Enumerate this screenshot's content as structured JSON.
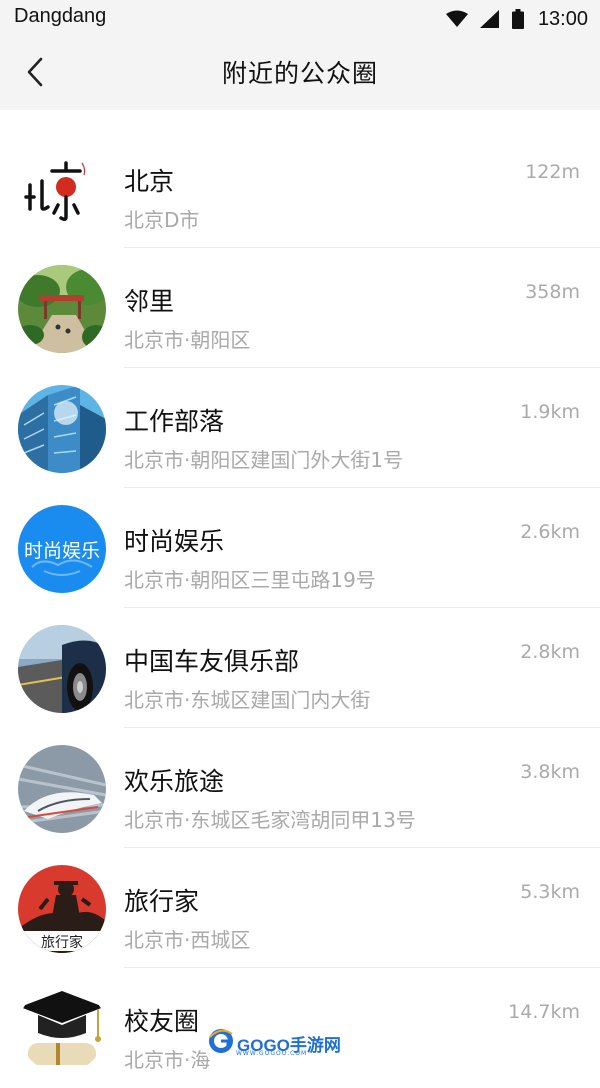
{
  "status_bar": {
    "carrier": "Dangdang",
    "time": "13:00",
    "icons": [
      "wifi-icon",
      "cellular-signal-icon",
      "battery-icon"
    ]
  },
  "nav": {
    "back_icon": "chevron-left-icon",
    "title": "附近的公众圈"
  },
  "circles": [
    {
      "name": "北京",
      "address": "北京D市",
      "distance": "122m"
    },
    {
      "name": "邻里",
      "address": "北京市·朝阳区",
      "distance": "358m"
    },
    {
      "name": "工作部落",
      "address": "北京市·朝阳区建国门外大街1号",
      "distance": "1.9km"
    },
    {
      "name": "时尚娱乐",
      "address": "北京市·朝阳区三里屯路19号",
      "distance": "2.6km",
      "avatar_text": "时尚娱乐"
    },
    {
      "name": "中国车友俱乐部",
      "address": "北京市·东城区建国门内大街",
      "distance": "2.8km"
    },
    {
      "name": "欢乐旅途",
      "address": "北京市·东城区毛家湾胡同甲13号",
      "distance": "3.8km"
    },
    {
      "name": "旅行家",
      "address": "北京市·西城区",
      "distance": "5.3km",
      "avatar_text": "旅行家"
    },
    {
      "name": "校友圈",
      "address": "北京市·海",
      "distance": "14.7km"
    }
  ],
  "watermark": {
    "text": "GOGO手游网",
    "sub": "WWW.GOGOO.COM"
  },
  "colors": {
    "accent_blue": "#1a8cf0",
    "text_primary": "#111111",
    "text_secondary": "#a9a9a9",
    "header_bg": "#f4f4f4"
  }
}
